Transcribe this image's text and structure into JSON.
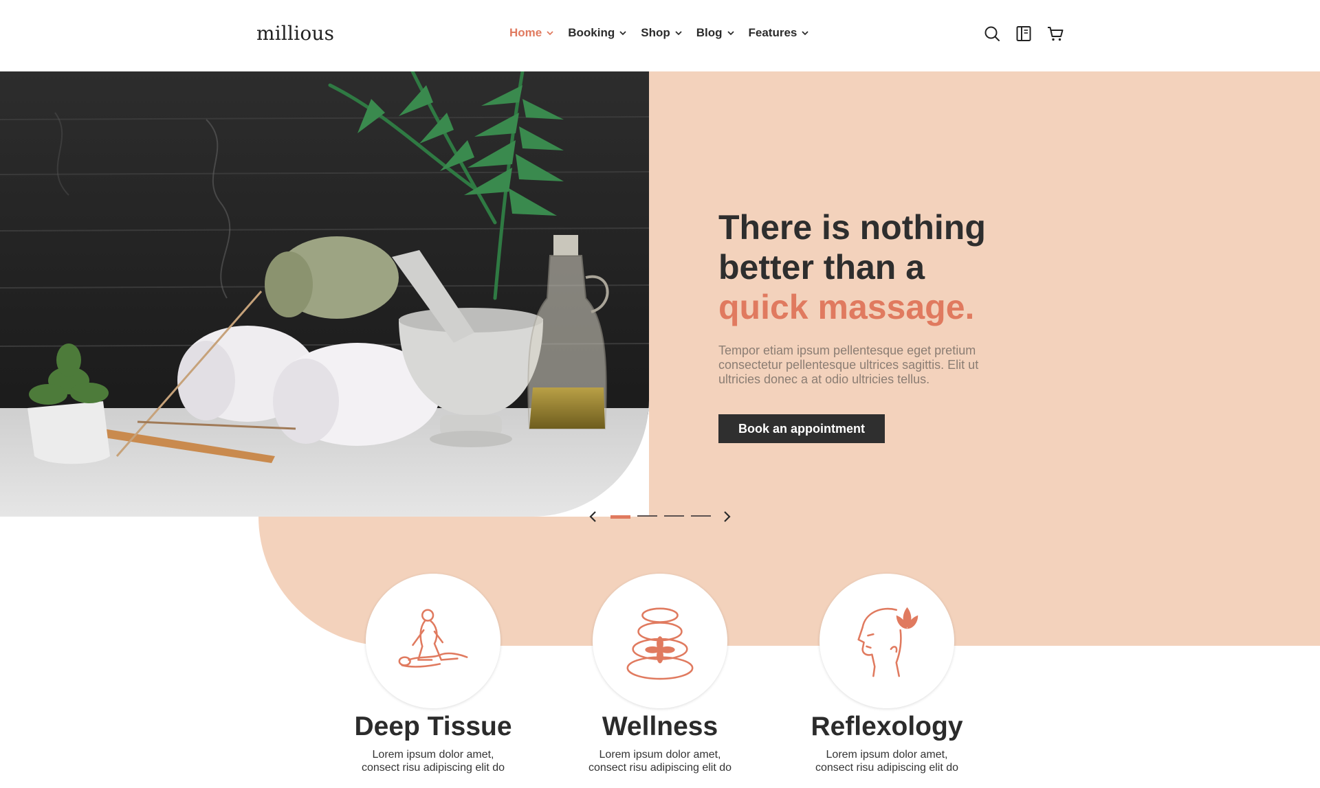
{
  "brand": {
    "logo": "millious"
  },
  "nav": {
    "items": [
      {
        "label": "Home",
        "active": true
      },
      {
        "label": "Booking"
      },
      {
        "label": "Shop"
      },
      {
        "label": "Blog"
      },
      {
        "label": "Features"
      }
    ]
  },
  "header_icons": [
    "search-icon",
    "book-icon",
    "cart-icon"
  ],
  "hero": {
    "title_line1": "There is nothing",
    "title_line2": "better than a",
    "title_accent": "quick massage.",
    "description": "Tempor etiam ipsum pellentesque eget pretium consectetur pellentesque ultrices sagittis. Elit ut ultricies donec a at odio ultricies tellus.",
    "cta": "Book an appointment",
    "slides": {
      "count": 4,
      "active": 1
    }
  },
  "services": [
    {
      "icon": "massage-icon",
      "title": "Deep Tissue",
      "text": "Lorem ipsum dolor amet, consect risu adipiscing elit do"
    },
    {
      "icon": "stones-icon",
      "title": "Wellness",
      "text": "Lorem ipsum dolor amet, consect risu adipiscing elit do"
    },
    {
      "icon": "head-lotus-icon",
      "title": "Reflexology",
      "text": "Lorem ipsum dolor amet, consect risu adipiscing elit do"
    }
  ],
  "colors": {
    "accent": "#e07a5f",
    "peach": "#f3d2bc",
    "dark": "#2f2f2f"
  }
}
